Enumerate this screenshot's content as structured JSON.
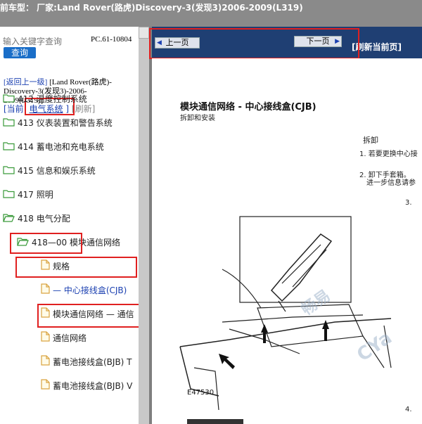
{
  "titlebar": {
    "text": "前车型： 厂家:Land Rover(路虎)Discovery-3(发现3)2006-2009(L319)"
  },
  "sidebar": {
    "search_placeholder": "输入关键字查询",
    "search_button": "查询",
    "pc_code": "PC.61-10804",
    "back_link": "[返回上一级]",
    "breadcrumb_text": "[Land Rover(路虎)-Discovery-3(发现3)-2006-2009(L319)]",
    "current_label": "[当前:",
    "current_system": "电气系统",
    "current_close": "]",
    "refresh_label": "[刷新]",
    "tree": [
      {
        "label": "412 温度控制系统",
        "type": "folder"
      },
      {
        "label": "413 仪表装置和警告系统",
        "type": "folder"
      },
      {
        "label": "414 蓄电池和充电系统",
        "type": "folder"
      },
      {
        "label": "415 信息和娱乐系统",
        "type": "folder"
      },
      {
        "label": "417 照明",
        "type": "folder"
      },
      {
        "label": "418 电气分配",
        "type": "folder-open"
      },
      {
        "label": "418—00 模块通信网络",
        "type": "folder-open"
      },
      {
        "label": "规格",
        "type": "doc"
      },
      {
        "label": "— 中心接线盒(CJB)",
        "type": "doc"
      },
      {
        "label": "模块通信网络 — 通信",
        "type": "doc"
      },
      {
        "label": "通信网络",
        "type": "doc"
      },
      {
        "label": "蓄电池接线盒(BJB) T",
        "type": "doc"
      },
      {
        "label": "蓄电池接线盒(BJB) V",
        "type": "doc"
      }
    ]
  },
  "toolbar": {
    "prev_label": "上一页",
    "next_label": "下一页",
    "refresh_home": "[刷新当前页]",
    "accent_color": "#1f3f73"
  },
  "content": {
    "title": "模块通信网络 - 中心接线盒(CJB)",
    "subtitle": "拆卸和安装",
    "section_heading": "拆卸",
    "step1": "1. 若要更换中心接",
    "step2": "2. 卸下手套箱。",
    "step2_note": "进一步信息请参",
    "step3": "3.",
    "step4": "4.",
    "figure_code": "E47530",
    "watermark_1": "畅易",
    "watermark_2": "CYa"
  }
}
